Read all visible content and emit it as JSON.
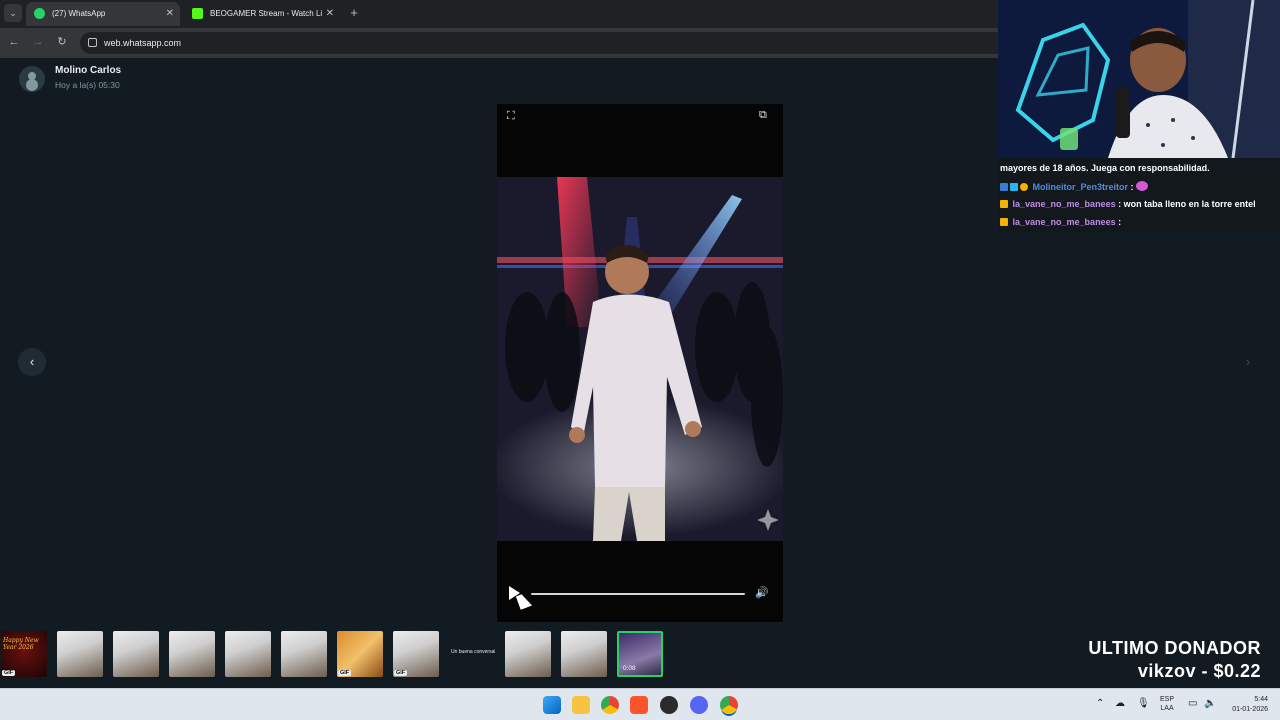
{
  "browser": {
    "tabs": [
      {
        "title": "(27) WhatsApp",
        "active": true,
        "favicon_color": "#25d366",
        "close": "✕"
      },
      {
        "title": "BEOGAMER Stream - Watch Li",
        "active": false,
        "favicon_color": "#53fc18",
        "close": "✕"
      }
    ],
    "new_tab": "+",
    "url": "web.whatsapp.com"
  },
  "viewer": {
    "sender_name": "Molino Carlos",
    "sender_time": "Hoy a la(s) 05:30",
    "prev_arrow": "‹",
    "next_arrow": "›",
    "video_progress": 0.0,
    "thumbnails": [
      {
        "kind": "new-year",
        "label": "Happy New Year 2026",
        "badge": "GIF"
      },
      {
        "kind": "photo",
        "badge": ""
      },
      {
        "kind": "photo",
        "badge": ""
      },
      {
        "kind": "photo",
        "badge": ""
      },
      {
        "kind": "photo",
        "badge": ""
      },
      {
        "kind": "photo",
        "badge": ""
      },
      {
        "kind": "food",
        "badge": "GIF"
      },
      {
        "kind": "photo",
        "badge": "GIF"
      },
      {
        "kind": "text",
        "caption": "Un buena conversal",
        "badge": ""
      },
      {
        "kind": "photo",
        "badge": ""
      },
      {
        "kind": "photo",
        "badge": ""
      },
      {
        "kind": "video",
        "duration": "0:08",
        "selected": true,
        "badge": ""
      }
    ]
  },
  "stream": {
    "chat": [
      {
        "user": "",
        "message": "mayores de 18 años. Juega con responsabilidad.",
        "user_color": "#ffffff"
      },
      {
        "user": "Molineitor_Pen3treitor",
        "message": ":",
        "user_color": "#4e8de0"
      },
      {
        "user": "la_vane_no_me_banees",
        "message": ": won taba lleno en la torre entel",
        "user_color": "#c08ce6"
      },
      {
        "user": "la_vane_no_me_banees",
        "message": ":",
        "user_color": "#c08ce6"
      }
    ],
    "donor_title": "ULTIMO DONADOR",
    "donor_line": "vikzov - $0.22"
  },
  "taskbar": {
    "lang_top": "ESP",
    "lang_bottom": "LAA",
    "time": "5:44",
    "date": "01-01-2026"
  }
}
